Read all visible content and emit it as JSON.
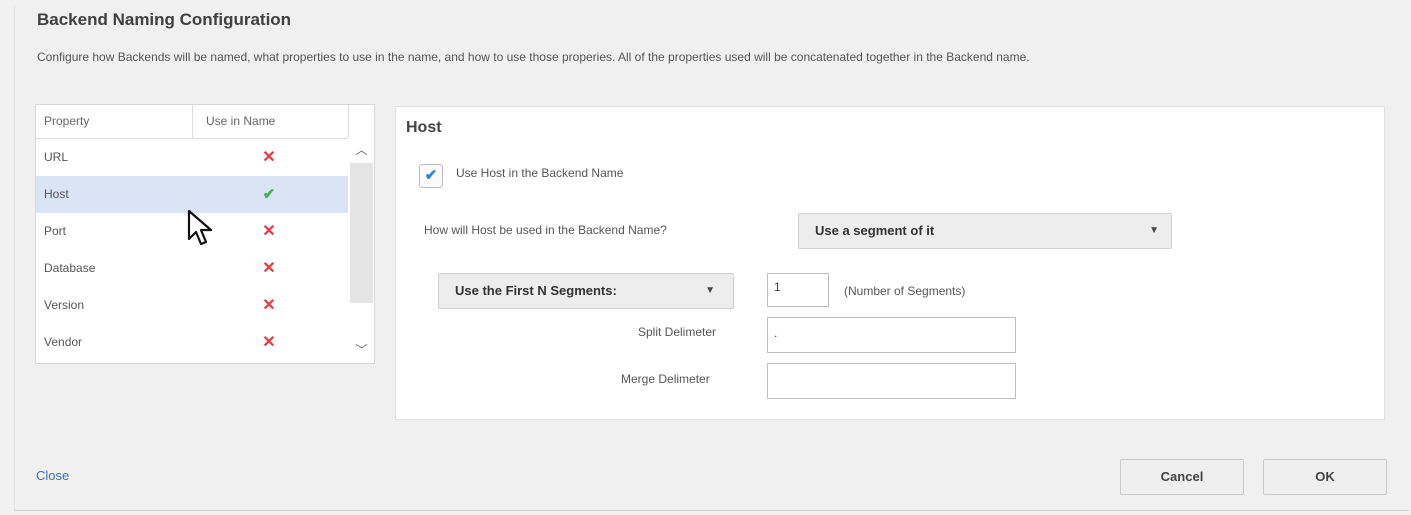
{
  "dialog": {
    "title": "Backend Naming Configuration",
    "description": "Configure how Backends will be named, what properties to use in the name, and how to use those properies.  All of the properties used will be concatenated together in the Backend name."
  },
  "property_table": {
    "headers": {
      "property": "Property",
      "use_in_name": "Use in Name"
    },
    "rows": [
      {
        "name": "URL",
        "used": false,
        "mark": "✕"
      },
      {
        "name": "Host",
        "used": true,
        "mark": "✔"
      },
      {
        "name": "Port",
        "used": false,
        "mark": "✕"
      },
      {
        "name": "Database",
        "used": false,
        "mark": "✕"
      },
      {
        "name": "Version",
        "used": false,
        "mark": "✕"
      },
      {
        "name": "Vendor",
        "used": false,
        "mark": "✕"
      }
    ],
    "selected_row": "Host",
    "scroll_up_icon": "chevron-up-icon",
    "scroll_down_icon": "chevron-down-icon"
  },
  "detail": {
    "title": "Host",
    "use_checkbox": {
      "checked": true,
      "label": "Use Host in the Backend Name"
    },
    "usage_label": "How will Host be used in the Backend Name?",
    "usage_select": "Use a segment of it",
    "segment_select": "Use the First N Segments:",
    "number_of_segments": "1",
    "number_hint": "(Number of Segments)",
    "split_delimiter_label": "Split Delimeter",
    "split_delimiter_value": ".",
    "merge_delimiter_label": "Merge Delimeter",
    "merge_delimiter_value": ""
  },
  "footer": {
    "close_label": "Close",
    "cancel_label": "Cancel",
    "ok_label": "OK"
  },
  "colors": {
    "selected_row": "#d9e4f5",
    "check_yes": "#3fb54a",
    "check_no": "#e8383d",
    "link": "#3d6fbf",
    "checkbox_tick": "#2a86d8"
  }
}
